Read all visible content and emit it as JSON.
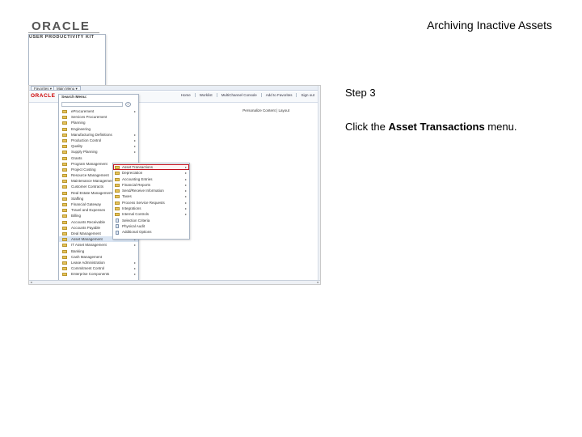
{
  "header": {
    "logo_word": "ORACLE",
    "logo_sub": "USER PRODUCTIVITY KIT",
    "title": "Archiving Inactive Assets"
  },
  "screenshot": {
    "favorites": "Favorites ▾",
    "main_menu": "Main Menu ▾",
    "brand": "ORACLE",
    "top_links": [
      "Home",
      "Worklist",
      "MultiChannel Console",
      "Add to Favorites",
      "Sign out"
    ],
    "personalize": "Personalize Content | Layout",
    "menu_title": "Search Menu:",
    "search_button": "»",
    "menu_items": [
      {
        "label": "eProcurement",
        "arrow": "▸"
      },
      {
        "label": "Services Procurement",
        "arrow": ""
      },
      {
        "label": "Planning",
        "arrow": ""
      },
      {
        "label": "Engineering",
        "arrow": ""
      },
      {
        "label": "Manufacturing Definitions",
        "arrow": "▸"
      },
      {
        "label": "Production Control",
        "arrow": "▸"
      },
      {
        "label": "Quality",
        "arrow": "▸"
      },
      {
        "label": "Supply Planning",
        "arrow": "▸"
      },
      {
        "label": "Grants",
        "arrow": ""
      },
      {
        "label": "Program Management",
        "arrow": ""
      },
      {
        "label": "Project Costing",
        "arrow": "▸"
      },
      {
        "label": "Resource Management",
        "arrow": "▸"
      },
      {
        "label": "Maintenance Management",
        "arrow": "▸"
      },
      {
        "label": "Customer Contracts",
        "arrow": "▸"
      },
      {
        "label": "Real Estate Management",
        "arrow": "▸"
      },
      {
        "label": "Staffing",
        "arrow": "▸"
      },
      {
        "label": "Financial Gateway",
        "arrow": "▸"
      },
      {
        "label": "Travel and Expenses",
        "arrow": "▸"
      },
      {
        "label": "Billing",
        "arrow": "▸"
      },
      {
        "label": "Accounts Receivable",
        "arrow": "▸"
      },
      {
        "label": "Accounts Payable",
        "arrow": "▸"
      },
      {
        "label": "Deal Management",
        "arrow": "▸"
      },
      {
        "label": "Asset Management",
        "arrow": "▸",
        "highlight": true
      },
      {
        "label": "IT Asset Management",
        "arrow": "▸"
      },
      {
        "label": "Banking",
        "arrow": ""
      },
      {
        "label": "Cash Management",
        "arrow": ""
      },
      {
        "label": "Lease Administration",
        "arrow": "▸"
      },
      {
        "label": "Commitment Control",
        "arrow": "▸"
      },
      {
        "label": "Enterprise Components",
        "arrow": "▸"
      }
    ],
    "submenu_items": [
      {
        "label": "Asset Transactions",
        "arrow": "▸",
        "icon": "folder",
        "target": true
      },
      {
        "label": "Depreciation",
        "arrow": "▸",
        "icon": "folder"
      },
      {
        "label": "Accounting Entries",
        "arrow": "▸",
        "icon": "folder"
      },
      {
        "label": "Financial Reports",
        "arrow": "▸",
        "icon": "folder"
      },
      {
        "label": "Send/Receive Information",
        "arrow": "▸",
        "icon": "folder"
      },
      {
        "label": "Taxes",
        "arrow": "▸",
        "icon": "folder"
      },
      {
        "label": "Process Service Requests",
        "arrow": "▸",
        "icon": "folder"
      },
      {
        "label": "Integrations",
        "arrow": "▸",
        "icon": "folder"
      },
      {
        "label": "Internal Controls",
        "arrow": "▸",
        "icon": "folder"
      },
      {
        "label": "Selection Criteria",
        "arrow": "",
        "icon": "doc"
      },
      {
        "label": "Physical Audit",
        "arrow": "",
        "icon": "doc"
      },
      {
        "label": "Additional Options",
        "arrow": "",
        "icon": "doc"
      }
    ],
    "scroll_left": "◂",
    "scroll_right": "▸"
  },
  "instructions": {
    "step": "Step 3",
    "pre": "Click the ",
    "bold": "Asset Transactions",
    "post": " menu."
  }
}
